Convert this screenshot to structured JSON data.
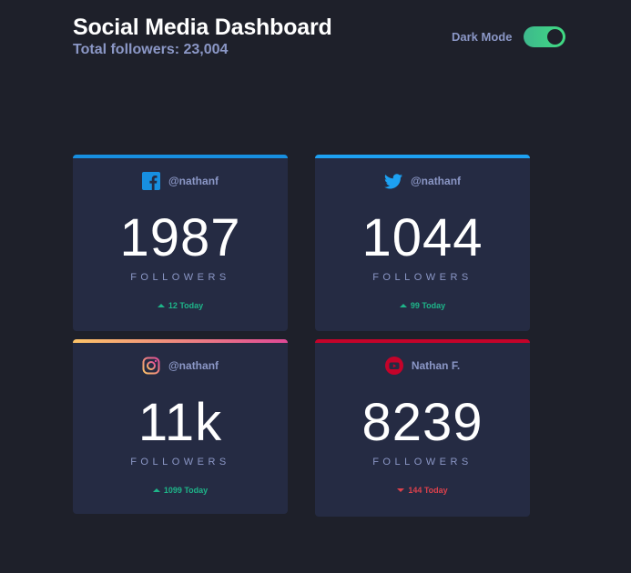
{
  "header": {
    "title": "Social Media Dashboard",
    "subtitle": "Total followers: 23,004",
    "dark_mode_label": "Dark Mode",
    "dark_mode_on": true
  },
  "colors": {
    "facebook": "#178fe0",
    "twitter": "#1da1f2",
    "instagram_start": "#fdc468",
    "instagram_end": "#df4996",
    "youtube": "#c4032a",
    "up": "#1eb589",
    "down": "#dc414c"
  },
  "cards": [
    {
      "platform_icon": "facebook-icon",
      "handle": "@nathanf",
      "count": "1987",
      "label": "FOLLOWERS",
      "change": "12 Today",
      "direction": "up"
    },
    {
      "platform_icon": "twitter-icon",
      "handle": "@nathanf",
      "count": "1044",
      "label": "FOLLOWERS",
      "change": "99 Today",
      "direction": "up"
    },
    {
      "platform_icon": "instagram-icon",
      "handle": "@nathanf",
      "count": "11k",
      "label": "FOLLOWERS",
      "change": "1099 Today",
      "direction": "up"
    },
    {
      "platform_icon": "youtube-icon",
      "handle": "Nathan F.",
      "count": "8239",
      "label": "FOLLOWERS",
      "change": "144 Today",
      "direction": "down"
    }
  ]
}
